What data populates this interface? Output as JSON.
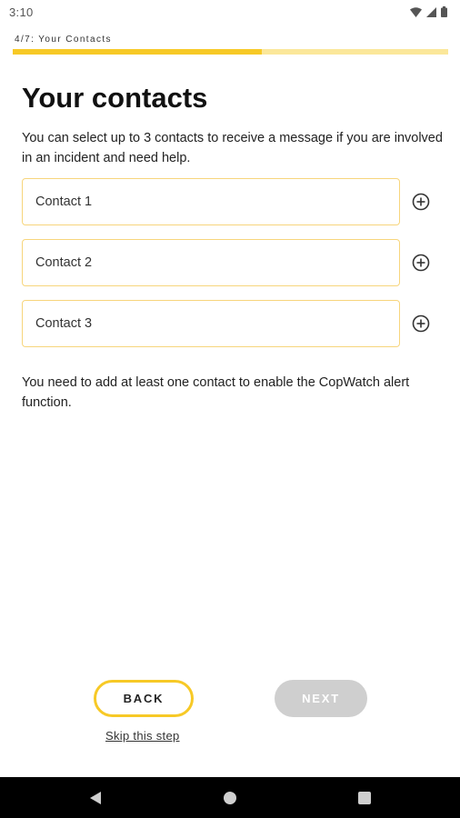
{
  "status_bar": {
    "time": "3:10",
    "icons": [
      "wifi-icon",
      "signal-icon",
      "battery-icon"
    ]
  },
  "progress": {
    "step_label": "4/7: Your Contacts",
    "fraction": 0.571
  },
  "main": {
    "title": "Your contacts",
    "description": "You can select up to 3 contacts to receive a message if you are involved in an incident and need help.",
    "contacts": [
      {
        "placeholder": "Contact 1",
        "action_icon": "add-circle-icon"
      },
      {
        "placeholder": "Contact 2",
        "action_icon": "add-circle-icon"
      },
      {
        "placeholder": "Contact 3",
        "action_icon": "add-circle-icon"
      }
    ],
    "helper_text": "You need to add at least one contact to enable the CopWatch alert function."
  },
  "footer": {
    "back_label": "BACK",
    "next_label": "NEXT",
    "skip_label": "Skip this step"
  },
  "nav_bar": {
    "icons": [
      "back-triangle-icon",
      "home-circle-icon",
      "recents-square-icon"
    ]
  },
  "colors": {
    "accent": "#f7c926",
    "accent_light": "#fbe79a",
    "field_border": "#f7d57c",
    "disabled_button": "#cfcfcf"
  }
}
